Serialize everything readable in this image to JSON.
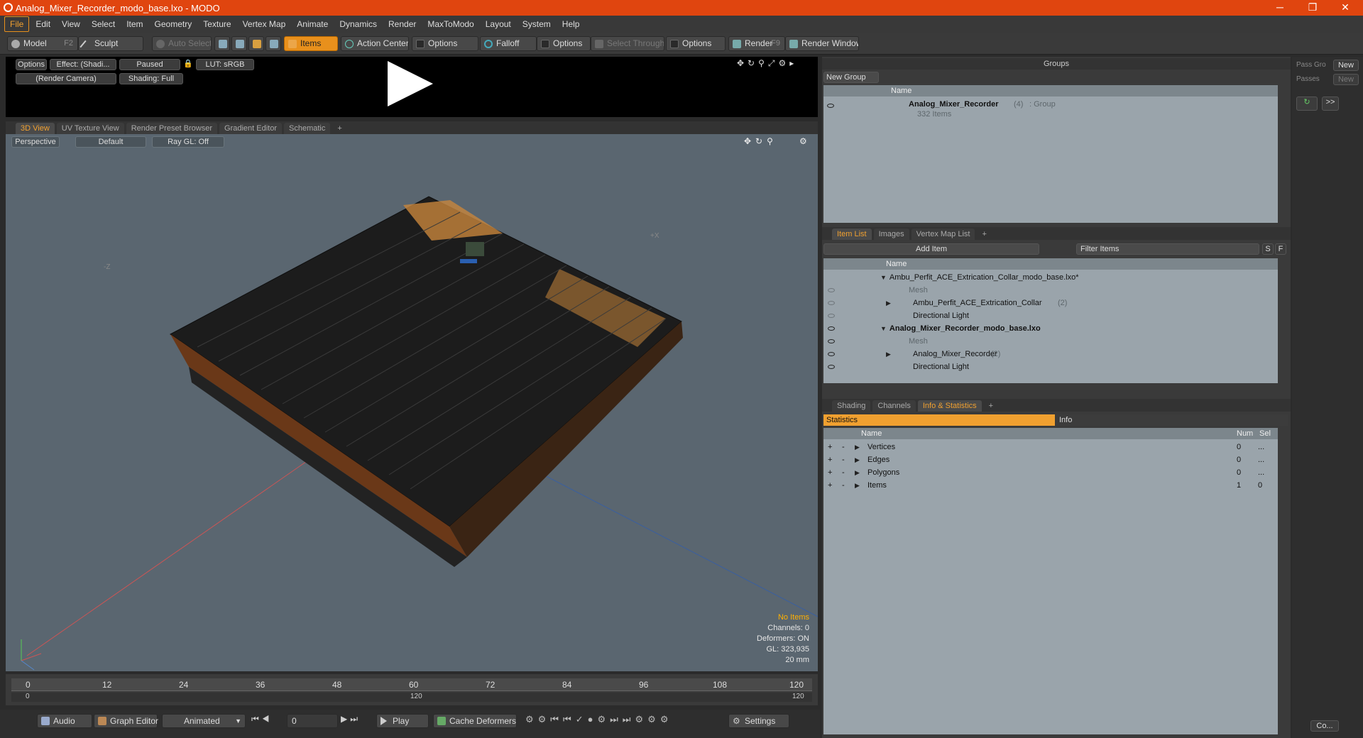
{
  "window": {
    "title": "Analog_Mixer_Recorder_modo_base.lxo - MODO",
    "minimize": "─",
    "maximize": "❐",
    "close": "✕"
  },
  "menu": [
    "File",
    "Edit",
    "View",
    "Select",
    "Item",
    "Geometry",
    "Texture",
    "Vertex Map",
    "Animate",
    "Dynamics",
    "Render",
    "MaxToModo",
    "Layout",
    "System",
    "Help"
  ],
  "toolbar": {
    "model": "Model",
    "model_key": "F2",
    "sculpt": "Sculpt",
    "auto_select": "Auto Select",
    "items": "Items",
    "action_center": "Action Center",
    "options1": "Options",
    "falloff": "Falloff",
    "options2": "Options",
    "select_through": "Select Through",
    "options3": "Options",
    "render": "Render",
    "render_key": "F9",
    "render_window": "Render Window"
  },
  "render_preview": {
    "options": "Options",
    "effect": "Effect: (Shadi...",
    "paused": "Paused",
    "lut": "LUT: sRGB",
    "camera": "(Render Camera)",
    "shading": "Shading: Full"
  },
  "view_tabs": [
    "3D View",
    "UV Texture View",
    "Render Preset Browser",
    "Gradient Editor",
    "Schematic",
    "+"
  ],
  "viewport": {
    "perspective": "Perspective",
    "default": "Default",
    "raygl": "Ray GL: Off",
    "axis_z": "-Z",
    "axis_x": "+X",
    "hud": {
      "no_items": "No Items",
      "channels": "Channels: 0",
      "deformers": "Deformers: ON",
      "gl": "GL: 323,935",
      "scale": "20 mm"
    }
  },
  "timeline": {
    "ticks": [
      "0",
      "12",
      "24",
      "36",
      "48",
      "60",
      "72",
      "84",
      "96",
      "108",
      "120"
    ],
    "range_start": "0",
    "range_mid": "120",
    "range_end": "120"
  },
  "bottombar": {
    "audio": "Audio",
    "graph_editor": "Graph Editor",
    "animated": "Animated",
    "frame": "0",
    "play": "Play",
    "cache_deformers": "Cache Deformers",
    "settings": "Settings"
  },
  "groups": {
    "title": "Groups",
    "new_group": "New Group",
    "col_name": "Name",
    "row_name": "Analog_Mixer_Recorder",
    "row_count": "(4)",
    "row_type": ": Group",
    "row_items": "332 Items"
  },
  "item_list": {
    "tabs": [
      "Item List",
      "Images",
      "Vertex Map List",
      "+"
    ],
    "add_item": "Add Item",
    "filter": "Filter Items",
    "btn_s": "S",
    "btn_f": "F",
    "col_name": "Name",
    "rows": [
      {
        "label": "Ambu_Perfit_ACE_Extrication_Collar_modo_base.lxo*",
        "count": ""
      },
      {
        "label": "Mesh",
        "count": ""
      },
      {
        "label": "Ambu_Perfit_ACE_Extrication_Collar",
        "count": "(2)"
      },
      {
        "label": "Directional Light",
        "count": ""
      },
      {
        "label": "Analog_Mixer_Recorder_modo_base.lxo",
        "count": ""
      },
      {
        "label": "Mesh",
        "count": ""
      },
      {
        "label": "Analog_Mixer_Recorder",
        "count": "(2)"
      },
      {
        "label": "Directional Light",
        "count": ""
      }
    ]
  },
  "stats": {
    "tabs": [
      "Shading",
      "Channels",
      "Info & Statistics",
      "+"
    ],
    "statistics": "Statistics",
    "info": "Info",
    "col_name": "Name",
    "col_num": "Num",
    "col_sel": "Sel",
    "rows": [
      {
        "name": "Vertices",
        "num": "0",
        "sel": "..."
      },
      {
        "name": "Edges",
        "num": "0",
        "sel": "..."
      },
      {
        "name": "Polygons",
        "num": "0",
        "sel": "..."
      },
      {
        "name": "Items",
        "num": "1",
        "sel": "0"
      }
    ]
  },
  "passes": {
    "pass_group": "Pass Gro",
    "passes": "Passes",
    "new1": "New",
    "new2": "New",
    "more": ">>",
    "collapse": "Co..."
  }
}
